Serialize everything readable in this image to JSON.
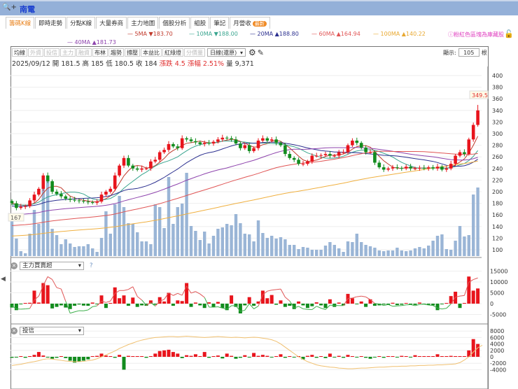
{
  "header": {
    "zoom_icon": "magnifier-plus-icon",
    "zoom_label": "+",
    "stock_name": "南電"
  },
  "tabs": [
    {
      "label": "籌碼K線",
      "active": true
    },
    {
      "label": "即時走勢"
    },
    {
      "label": "分點K線"
    },
    {
      "label": "大量券商"
    },
    {
      "label": "主力地圖"
    },
    {
      "label": "個股分析"
    },
    {
      "label": "組股"
    },
    {
      "label": "筆記"
    },
    {
      "label": "月營收",
      "badge": "最新"
    }
  ],
  "ma_legend": [
    {
      "label": "5MA ▼183.70",
      "color": "#c0392b"
    },
    {
      "label": "10MA ▼188.00",
      "color": "#3aa58f"
    },
    {
      "label": "20MA ▲188.80",
      "color": "#2b2f8f"
    },
    {
      "label": "60MA ▲164.94",
      "color": "#e05555"
    },
    {
      "label": "100MA ▲140.22",
      "color": "#f0b040"
    },
    {
      "label": "40MA ▲181.73",
      "color": "#8e44ad"
    }
  ],
  "note": "ⓘ粉紅色區塊為庫藏股",
  "toolbar": {
    "buttons": [
      {
        "label": "均線"
      },
      {
        "label": "外資",
        "disabled": true
      },
      {
        "label": "投信",
        "disabled": true
      },
      {
        "label": "主力",
        "disabled": true
      },
      {
        "label": "融資",
        "disabled": true
      },
      {
        "label": "布林"
      },
      {
        "label": "趨勢"
      },
      {
        "label": "撐壓"
      },
      {
        "label": "本益比"
      },
      {
        "label": "紅綠燈"
      },
      {
        "label": "分價量",
        "disabled": true
      }
    ],
    "period": "日線(還原)",
    "show_label": "顯示:",
    "show_value": "105",
    "show_unit": "根"
  },
  "info": {
    "date": "2025/09/12",
    "open": "開 181.5",
    "high": "高 185",
    "low": "低 180.5",
    "close": "收 184",
    "change": "漲跌 4.5",
    "pct": "漲幅 2.51%",
    "volume": "量 9,371"
  },
  "panels": {
    "p1_indicator": "主力買賣超",
    "p1_help": "?",
    "p2_indicator": "投信"
  },
  "colors": {
    "up": "#e8141c",
    "down": "#128c1e",
    "volume": "#9ab5d6"
  },
  "chart_data": [
    {
      "type": "candlestick",
      "title": "南電 日線",
      "ylim": [
        100,
        400
      ],
      "yticks": [
        100,
        120,
        140,
        160,
        180,
        200,
        220,
        240,
        260,
        280,
        300,
        320,
        340,
        360,
        380,
        400
      ],
      "last_high_label": "349.5",
      "left_marker": "167",
      "close": [
        180,
        172,
        174,
        175,
        185,
        195,
        205,
        228,
        218,
        200,
        196,
        192,
        188,
        186,
        185,
        184,
        183,
        182,
        181,
        183,
        195,
        200,
        205,
        228,
        245,
        258,
        245,
        240,
        238,
        240,
        240,
        252,
        255,
        268,
        272,
        282,
        278,
        275,
        292,
        290,
        287,
        285,
        282,
        284,
        283,
        286,
        290,
        293,
        292,
        290,
        283,
        275,
        280,
        270,
        275,
        288,
        292,
        288,
        290,
        284,
        280,
        265,
        258,
        255,
        248,
        248,
        252,
        262,
        262,
        263,
        265,
        262,
        262,
        268,
        268,
        280,
        288,
        284,
        276,
        268,
        268,
        250,
        242,
        238,
        240,
        242,
        241,
        240,
        243,
        240,
        240,
        241,
        240,
        242,
        240,
        243,
        238,
        240,
        248,
        262,
        268,
        265,
        290,
        315,
        340
      ],
      "volume": [
        5100,
        2500,
        700,
        400,
        3200,
        6600,
        4600,
        9900,
        10800,
        3900,
        3000,
        1700,
        2400,
        1800,
        1300,
        1400,
        1400,
        1700,
        1100,
        600,
        2600,
        6400,
        3200,
        7400,
        8600,
        7000,
        4700,
        4600,
        3400,
        2100,
        2100,
        1700,
        7400,
        7000,
        4000,
        11300,
        4600,
        7000,
        7500,
        11900,
        4300,
        3600,
        2300,
        3500,
        1800,
        2900,
        3900,
        4100,
        4600,
        4400,
        6000,
        4700,
        3200,
        3100,
        2100,
        5100,
        3300,
        2600,
        2900,
        2500,
        2700,
        2400,
        1600,
        1600,
        1000,
        1300,
        1200,
        900,
        900,
        900,
        1500,
        2000,
        1600,
        1100,
        600,
        2100,
        2000,
        3200,
        2000,
        1600,
        1400,
        1200,
        800,
        700,
        800,
        800,
        1200,
        800,
        700,
        800,
        1100,
        1300,
        1100,
        1500,
        2200,
        2900,
        3100,
        1000,
        900,
        2200,
        4300,
        2800,
        3000,
        8800,
        9800
      ],
      "ma_periods": [
        5,
        10,
        20,
        40,
        60,
        100
      ],
      "ma_seed": {
        "5": 180,
        "10": 178,
        "20": 175,
        "40": 160,
        "60": 141,
        "100": 123
      }
    },
    {
      "type": "bar+line",
      "name": "主力買賣超",
      "yticks": [
        -5000,
        0,
        5000,
        10000,
        15000
      ],
      "ylim": [
        -7000,
        17000
      ],
      "values": [
        -1800,
        -3000,
        -300,
        300,
        400,
        6000,
        500,
        9500,
        8500,
        -2200,
        -1500,
        -800,
        -1800,
        -2500,
        -1000,
        -400,
        -900,
        -1000,
        500,
        -200,
        3800,
        -2000,
        300,
        7500,
        2500,
        3800,
        -1000,
        2800,
        -1500,
        -800,
        -1000,
        1500,
        -500,
        3000,
        1000,
        5000,
        -1000,
        1500,
        1200,
        9500,
        -1500,
        500,
        -800,
        -2000,
        600,
        -1500,
        800,
        -2000,
        -3000,
        3800,
        -1500,
        -4500,
        -800,
        3000,
        -1000,
        1000,
        6000,
        2500,
        4000,
        -500,
        1500,
        -1500,
        -1000,
        -2500,
        1000,
        -800,
        -2000,
        -1200,
        600,
        -800,
        -2000,
        2000,
        -1500,
        500,
        -800,
        4500,
        2500,
        -300,
        1000,
        -1500,
        2000,
        -1000,
        -800,
        -400,
        -600,
        400,
        -700,
        -500,
        300,
        -400,
        -600,
        500,
        -300,
        -500,
        -800,
        -3000,
        -300,
        300,
        3500,
        5500,
        -2000,
        200,
        12500,
        6000,
        7000
      ]
    },
    {
      "type": "bar+line",
      "name": "投信",
      "yticks": [
        -4000,
        -2000,
        0,
        2000,
        4000,
        6000,
        8000
      ],
      "ylim": [
        -5000,
        9000
      ],
      "values": [
        -300,
        -200,
        0,
        -300,
        200,
        600,
        1500,
        400,
        -200,
        -600,
        -300,
        200,
        -400,
        -1200,
        -1800,
        -1500,
        -1200,
        -800,
        0,
        300,
        1000,
        400,
        200,
        -300,
        600,
        -4000,
        300,
        200,
        100,
        0,
        -300,
        200,
        1000,
        1800,
        2000,
        2200,
        1500,
        1000,
        -400,
        500,
        300,
        800,
        200,
        1500,
        -300,
        200,
        400,
        -500,
        1000,
        300,
        -600,
        -300,
        500,
        -200,
        1200,
        300,
        600,
        300,
        -200,
        200,
        800,
        -300,
        0,
        -200,
        200,
        -800,
        300,
        600,
        -300,
        200,
        -400,
        1000,
        -200,
        300,
        -300,
        600,
        200,
        -200,
        0,
        -300,
        -600,
        -200,
        200,
        -300,
        100,
        0,
        -200,
        300,
        200,
        -100,
        500,
        100,
        0,
        100,
        200,
        800,
        100,
        100,
        300,
        200,
        200,
        200,
        2000,
        5500,
        4000
      ],
      "line": [
        -2700,
        -2500,
        -2300,
        -2000,
        -1700,
        -1500,
        -1200,
        -800,
        -600,
        -700,
        -900,
        -1100,
        -1300,
        -1400,
        -1500,
        -1500,
        -1400,
        -1200,
        -1000,
        -600,
        0,
        600,
        1200,
        1800,
        2600,
        3200,
        3800,
        4300,
        4800,
        5200,
        5500,
        5800,
        6000,
        6100,
        6200,
        6300,
        6300,
        6200,
        6300,
        6400,
        6300,
        6200,
        6100,
        6000,
        6100,
        6200,
        6300,
        6200,
        6100,
        6000,
        6100,
        6000,
        5900,
        6000,
        6100,
        6000,
        5800,
        5600,
        5300,
        4800,
        4000,
        3000,
        2000,
        1000,
        0,
        -800,
        -1500,
        -2000,
        -2500,
        -2800,
        -3000,
        -3200,
        -3300,
        -3500,
        -3600,
        -3700,
        -3700,
        -3600,
        -3500,
        -3500,
        -3400,
        -3300,
        -3200,
        -3200,
        -3100,
        -3000,
        -3000,
        -2900,
        -2900,
        -2800,
        -2800,
        -2700,
        -2700,
        -2600,
        -2600,
        -2500,
        -2500,
        -2400,
        -2300,
        -2200,
        -1800,
        -1000,
        0,
        1500,
        2800,
        3600
      ]
    }
  ]
}
